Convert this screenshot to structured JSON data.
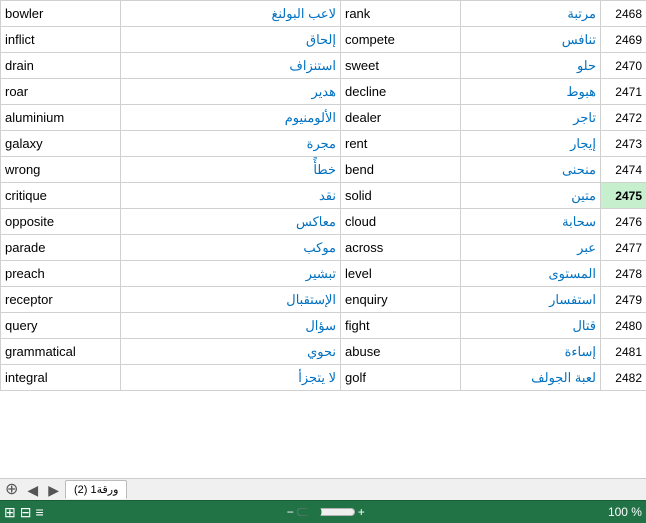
{
  "colors": {
    "green_header": "#217346",
    "highlighted_row_bg": "#c6efce"
  },
  "rows": [
    {
      "english": "bowler",
      "arabic": "لاعب البولنغ",
      "english2": "rank",
      "arabic2": "مرتبة",
      "num": "2468",
      "highlighted": false
    },
    {
      "english": "inflict",
      "arabic": "إلحاق",
      "english2": "compete",
      "arabic2": "تنافس",
      "num": "2469",
      "highlighted": false
    },
    {
      "english": "drain",
      "arabic": "استنزاف",
      "english2": "sweet",
      "arabic2": "حلو",
      "num": "2470",
      "highlighted": false
    },
    {
      "english": "roar",
      "arabic": "هدير",
      "english2": "decline",
      "arabic2": "هبوط",
      "num": "2471",
      "highlighted": false
    },
    {
      "english": "aluminium",
      "arabic": "الألومنيوم",
      "english2": "dealer",
      "arabic2": "تاجر",
      "num": "2472",
      "highlighted": false
    },
    {
      "english": "galaxy",
      "arabic": "مجرة",
      "english2": "rent",
      "arabic2": "إيجار",
      "num": "2473",
      "highlighted": false
    },
    {
      "english": "wrong",
      "arabic": "خطأً",
      "english2": "bend",
      "arabic2": "منحنى",
      "num": "2474",
      "highlighted": false
    },
    {
      "english": "critique",
      "arabic": "نقد",
      "english2": "solid",
      "arabic2": "متين",
      "num": "2475",
      "highlighted": true
    },
    {
      "english": "opposite",
      "arabic": "معاكس",
      "english2": "cloud",
      "arabic2": "سحابة",
      "num": "2476",
      "highlighted": false
    },
    {
      "english": "parade",
      "arabic": "موكب",
      "english2": "across",
      "arabic2": "عبر",
      "num": "2477",
      "highlighted": false
    },
    {
      "english": "preach",
      "arabic": "تبشير",
      "english2": "level",
      "arabic2": "المستوى",
      "num": "2478",
      "highlighted": false
    },
    {
      "english": "receptor",
      "arabic": "الإستقبال",
      "english2": "enquiry",
      "arabic2": "استفسار",
      "num": "2479",
      "highlighted": false
    },
    {
      "english": "query",
      "arabic": "سؤال",
      "english2": "fight",
      "arabic2": "قتال",
      "num": "2480",
      "highlighted": false
    },
    {
      "english": "grammatical",
      "arabic": "نحوي",
      "english2": "abuse",
      "arabic2": "إساءة",
      "num": "2481",
      "highlighted": false
    },
    {
      "english": "integral",
      "arabic": "لا يتجزأ",
      "english2": "golf",
      "arabic2": "لعبة الجولف",
      "num": "2482",
      "highlighted": false
    }
  ],
  "tab": {
    "label": "ورقة1 (2)",
    "add_button": "⊕",
    "nav_left": "◀",
    "nav_right": "▶"
  },
  "status_bar": {
    "icons": [
      "⊞",
      "⊟",
      "≡"
    ],
    "zoom_label": "100 %",
    "slider_value": 100
  }
}
